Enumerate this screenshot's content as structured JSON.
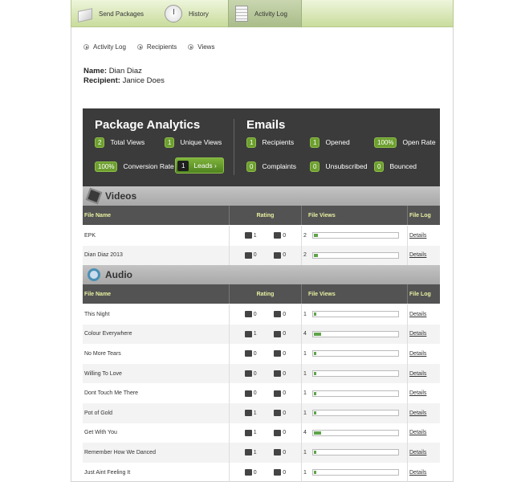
{
  "tabs": [
    {
      "label": "Send Packages"
    },
    {
      "label": "History"
    },
    {
      "label": "Activity Log"
    }
  ],
  "subnav": [
    {
      "label": "Activity Log"
    },
    {
      "label": "Recipients"
    },
    {
      "label": "Views"
    }
  ],
  "info": {
    "name_label": "Name:",
    "name": "Dian Diaz",
    "recipient_label": "Recipient:",
    "recipient": "Janice Does"
  },
  "analytics": {
    "title": "Package Analytics",
    "total_views": "2",
    "total_views_label": "Total Views",
    "unique_views": "1",
    "unique_views_label": "Unique Views",
    "conversion_rate": "100%",
    "conversion_rate_label": "Conversion Rate",
    "leads_count": "1",
    "leads_label": "Leads ›"
  },
  "emails": {
    "title": "Emails",
    "recipients": "1",
    "recipients_label": "Recipients",
    "opened": "1",
    "opened_label": "Opened",
    "open_rate": "100%",
    "open_rate_label": "Open Rate",
    "complaints": "0",
    "complaints_label": "Complaints",
    "unsubscribed": "0",
    "unsubscribed_label": "Unsubscribed",
    "bounced": "0",
    "bounced_label": "Bounced"
  },
  "columns": {
    "file": "File Name",
    "rating": "Rating",
    "views": "File Views",
    "log": "File Log"
  },
  "videos": {
    "title": "Videos",
    "rows": [
      {
        "name": "EPK",
        "up": "1",
        "down": "0",
        "views": "2",
        "fill": 0.05,
        "log": "Details"
      },
      {
        "name": "Dian Diaz 2013",
        "up": "0",
        "down": "0",
        "views": "2",
        "fill": 0.05,
        "log": "Details"
      }
    ]
  },
  "audio": {
    "title": "Audio",
    "rows": [
      {
        "name": "This Night",
        "up": "0",
        "down": "0",
        "views": "1",
        "fill": 0.03,
        "log": "Details"
      },
      {
        "name": "Colour Everywhere",
        "up": "1",
        "down": "0",
        "views": "4",
        "fill": 0.09,
        "log": "Details"
      },
      {
        "name": "No More Tears",
        "up": "0",
        "down": "0",
        "views": "1",
        "fill": 0.03,
        "log": "Details"
      },
      {
        "name": "Willing To Love",
        "up": "0",
        "down": "0",
        "views": "1",
        "fill": 0.03,
        "log": "Details"
      },
      {
        "name": "Dont Touch Me There",
        "up": "0",
        "down": "0",
        "views": "1",
        "fill": 0.03,
        "log": "Details"
      },
      {
        "name": "Pot of Gold",
        "up": "1",
        "down": "0",
        "views": "1",
        "fill": 0.03,
        "log": "Details"
      },
      {
        "name": "Get With You",
        "up": "1",
        "down": "0",
        "views": "4",
        "fill": 0.09,
        "log": "Details"
      },
      {
        "name": "Remember How We Danced",
        "up": "1",
        "down": "0",
        "views": "1",
        "fill": 0.03,
        "log": "Details"
      },
      {
        "name": "Just Aint Feeling It",
        "up": "0",
        "down": "0",
        "views": "1",
        "fill": 0.03,
        "log": "Details"
      }
    ]
  }
}
